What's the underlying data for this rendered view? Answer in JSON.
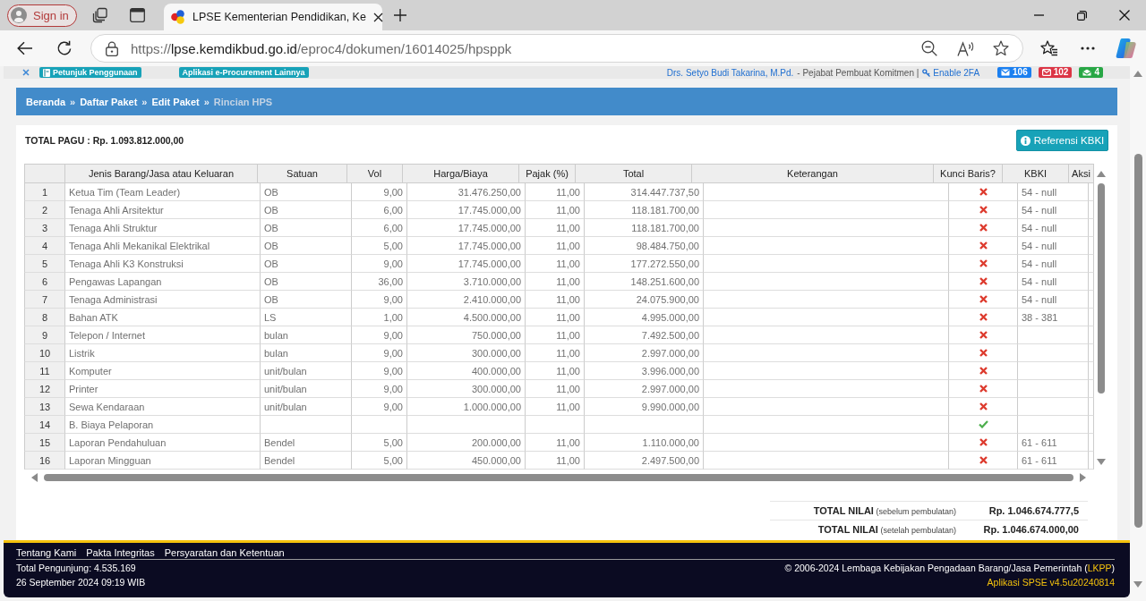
{
  "browser": {
    "sign_in": "Sign in",
    "tab": {
      "title": "LPSE Kementerian Pendidikan, Ke"
    },
    "url": {
      "scheme": "https://",
      "host": "lpse.kemdikbud.go.id",
      "path": "/eproc4/dokumen/16014025/hpsppk"
    }
  },
  "top_bar": {
    "links": [
      "Petunjuk Penggunaan",
      "Aplikasi e-Procurement Lainnya"
    ],
    "user": "Drs. Setyo Budi Takarina, M.Pd.",
    "role": "- Pejabat Pembuat Komitmen |",
    "two_fa": "Enable 2FA",
    "badges": [
      {
        "count": "106",
        "color": "#1a7ff0"
      },
      {
        "count": "102",
        "color": "#dc3545"
      },
      {
        "count": "4",
        "color": "#28a745"
      }
    ]
  },
  "breadcrumb": [
    {
      "label": "Beranda",
      "current": false
    },
    {
      "separator": "»",
      "label": "Daftar Paket",
      "current": false
    },
    {
      "separator": "»",
      "label": "Edit Paket",
      "current": false
    },
    {
      "separator": "»",
      "label": "Rincian HPS",
      "current": true
    }
  ],
  "total_pagu": "TOTAL PAGU : Rp. 1.093.812.000,00",
  "reference_button": "Referensi KBKI",
  "table": {
    "columns": [
      "Jenis Barang/Jasa atau Keluaran",
      "Satuan",
      "Vol",
      "Harga/Biaya",
      "Pajak (%)",
      "Total",
      "Keterangan",
      "Kunci Baris?",
      "KBKI",
      "Aksi"
    ],
    "rows": [
      {
        "no": "1",
        "item": "Ketua Tim (Team Leader)",
        "unit": "OB",
        "vol": "9,00",
        "price": "31.476.250,00",
        "tax": "11,00",
        "total": "314.447.737,50",
        "locked": false,
        "kbki": "54 - null"
      },
      {
        "no": "2",
        "item": "Tenaga Ahli Arsitektur",
        "unit": "OB",
        "vol": "6,00",
        "price": "17.745.000,00",
        "tax": "11,00",
        "total": "118.181.700,00",
        "locked": false,
        "kbki": "54 - null"
      },
      {
        "no": "3",
        "item": "Tenaga Ahli Struktur",
        "unit": "OB",
        "vol": "6,00",
        "price": "17.745.000,00",
        "tax": "11,00",
        "total": "118.181.700,00",
        "locked": false,
        "kbki": "54 - null"
      },
      {
        "no": "4",
        "item": "Tenaga Ahli Mekanikal Elektrikal",
        "unit": "OB",
        "vol": "5,00",
        "price": "17.745.000,00",
        "tax": "11,00",
        "total": "98.484.750,00",
        "locked": false,
        "kbki": "54 - null"
      },
      {
        "no": "5",
        "item": "Tenaga Ahli K3 Konstruksi",
        "unit": "OB",
        "vol": "9,00",
        "price": "17.745.000,00",
        "tax": "11,00",
        "total": "177.272.550,00",
        "locked": false,
        "kbki": "54 - null"
      },
      {
        "no": "6",
        "item": "Pengawas Lapangan",
        "unit": "OB",
        "vol": "36,00",
        "price": "3.710.000,00",
        "tax": "11,00",
        "total": "148.251.600,00",
        "locked": false,
        "kbki": "54 - null"
      },
      {
        "no": "7",
        "item": "Tenaga Administrasi",
        "unit": "OB",
        "vol": "9,00",
        "price": "2.410.000,00",
        "tax": "11,00",
        "total": "24.075.900,00",
        "locked": false,
        "kbki": "54 - null"
      },
      {
        "no": "8",
        "item": "Bahan ATK",
        "unit": "LS",
        "vol": "1,00",
        "price": "4.500.000,00",
        "tax": "11,00",
        "total": "4.995.000,00",
        "locked": false,
        "kbki": "38 - 381"
      },
      {
        "no": "9",
        "item": "Telepon / Internet",
        "unit": "bulan",
        "vol": "9,00",
        "price": "750.000,00",
        "tax": "11,00",
        "total": "7.492.500,00",
        "locked": false
      },
      {
        "no": "10",
        "item": "Listrik",
        "unit": "bulan",
        "vol": "9,00",
        "price": "300.000,00",
        "tax": "11,00",
        "total": "2.997.000,00",
        "locked": false
      },
      {
        "no": "11",
        "item": "Komputer",
        "unit": "unit/bulan",
        "vol": "9,00",
        "price": "400.000,00",
        "tax": "11,00",
        "total": "3.996.000,00",
        "locked": false
      },
      {
        "no": "12",
        "item": "Printer",
        "unit": "unit/bulan",
        "vol": "9,00",
        "price": "300.000,00",
        "tax": "11,00",
        "total": "2.997.000,00",
        "locked": false
      },
      {
        "no": "13",
        "item": "Sewa Kendaraan",
        "unit": "unit/bulan",
        "vol": "9,00",
        "price": "1.000.000,00",
        "tax": "11,00",
        "total": "9.990.000,00",
        "locked": false
      },
      {
        "no": "14",
        "item": "B. Biaya Pelaporan",
        "locked": true
      },
      {
        "no": "15",
        "item": "Laporan Pendahuluan",
        "unit": "Bendel",
        "vol": "5,00",
        "price": "200.000,00",
        "tax": "11,00",
        "total": "1.110.000,00",
        "locked": false,
        "kbki": "61 - 611"
      },
      {
        "no": "16",
        "item": "Laporan Mingguan",
        "unit": "Bendel",
        "vol": "5,00",
        "price": "450.000,00",
        "tax": "11,00",
        "total": "2.497.500,00",
        "locked": false,
        "kbki": "61 - 611"
      }
    ]
  },
  "totals": [
    {
      "label": "**TOTAL NILAI** (sebelum pembulatan)",
      "value": "Rp. 1.046.674.777,5"
    },
    {
      "label": "**TOTAL NILAI** (setelah pembulatan)",
      "value": "Rp. 1.046.674.000,00"
    }
  ],
  "footer": {
    "links": [
      "Tentang Kami",
      "Pakta Integritas",
      "Persyaratan dan Ketentuan"
    ],
    "visitors": "Total Pengunjung: 4.535.169",
    "datetime": "26 September 2024 09:19 WIB",
    "copyright": {
      "before": "© 2006-2024 Lembaga Kebijakan Pengadaan Barang/Jasa Pemerintah (",
      "link": "LKPP",
      "after": ")"
    },
    "version": "Aplikasi SPSE v4.5u20240814"
  }
}
